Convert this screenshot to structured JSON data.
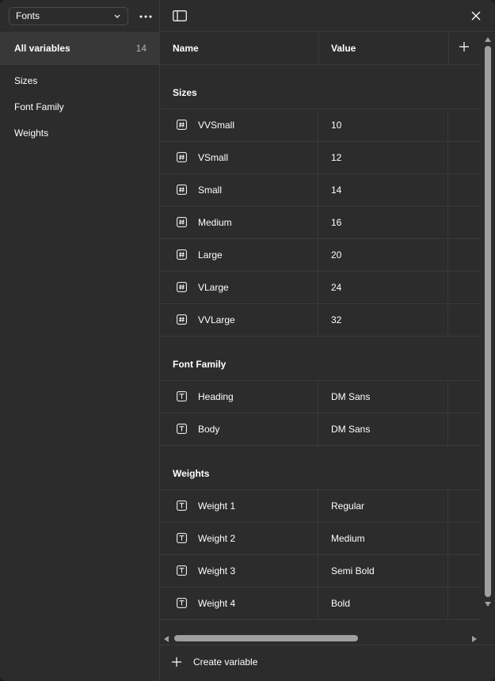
{
  "sidebar": {
    "collection_select": "Fonts",
    "all_variables": {
      "label": "All variables",
      "count": "14"
    },
    "groups": [
      "Sizes",
      "Font Family",
      "Weights"
    ]
  },
  "table": {
    "columns": {
      "name": "Name",
      "value": "Value"
    },
    "groups": [
      {
        "title": "Sizes",
        "type_icon": "number-icon",
        "rows": [
          {
            "name": "VVSmall",
            "value": "10"
          },
          {
            "name": "VSmall",
            "value": "12"
          },
          {
            "name": "Small",
            "value": "14"
          },
          {
            "name": "Medium",
            "value": "16"
          },
          {
            "name": "Large",
            "value": "20"
          },
          {
            "name": "VLarge",
            "value": "24"
          },
          {
            "name": "VVLarge",
            "value": "32"
          }
        ]
      },
      {
        "title": "Font Family",
        "type_icon": "text-icon",
        "rows": [
          {
            "name": "Heading",
            "value": "DM Sans"
          },
          {
            "name": "Body",
            "value": "DM Sans"
          }
        ]
      },
      {
        "title": "Weights",
        "type_icon": "text-icon",
        "rows": [
          {
            "name": "Weight 1",
            "value": "Regular"
          },
          {
            "name": "Weight 2",
            "value": "Medium"
          },
          {
            "name": "Weight 3",
            "value": "Semi Bold"
          },
          {
            "name": "Weight 4",
            "value": "Bold"
          }
        ]
      }
    ]
  },
  "footer": {
    "create_label": "Create variable"
  },
  "colors": {
    "background": "#2c2c2c",
    "selected_row": "#383838",
    "divider": "#3a3a3a",
    "text": "#ffffff",
    "muted_text": "#b3b3b3",
    "scrollbar": "#a0a0a0"
  }
}
